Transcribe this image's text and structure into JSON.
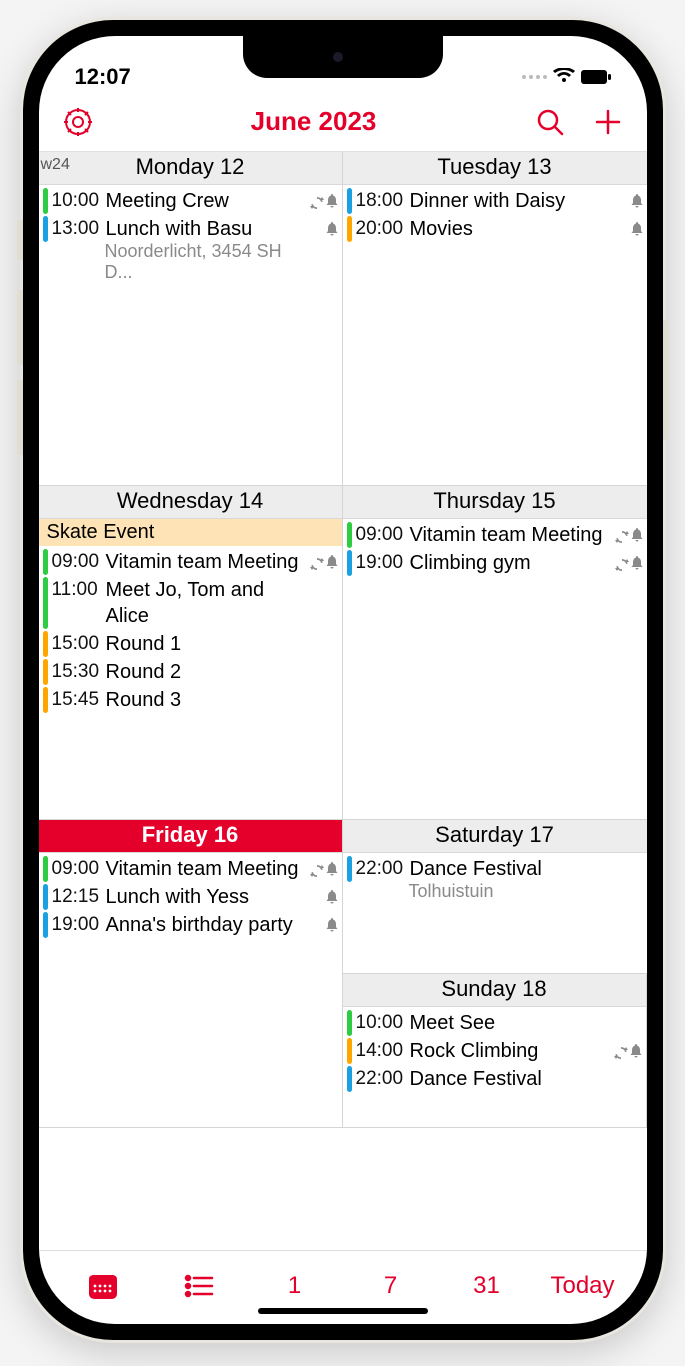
{
  "status": {
    "time": "12:07"
  },
  "header": {
    "title": "June 2023"
  },
  "week_label": "w24",
  "days": [
    {
      "label": "Monday 12",
      "events": [
        {
          "color": "green",
          "time": "10:00",
          "title": "Meeting Crew",
          "repeat": true,
          "bell": true
        },
        {
          "color": "blue",
          "time": "13:00",
          "title": "Lunch with Basu",
          "location": "Noorderlicht, 3454 SH D...",
          "bell": true
        }
      ]
    },
    {
      "label": "Tuesday 13",
      "events": [
        {
          "color": "blue",
          "time": "18:00",
          "title": "Dinner with Daisy",
          "bell": true
        },
        {
          "color": "orange",
          "time": "20:00",
          "title": "Movies",
          "bell": true
        }
      ]
    },
    {
      "label": "Wednesday 14",
      "allday": {
        "color": "orange",
        "title": "Skate Event"
      },
      "events": [
        {
          "color": "green",
          "time": "09:00",
          "title": "Vitamin team Meeting",
          "repeat": true,
          "bell": true
        },
        {
          "color": "green",
          "time": "11:00",
          "title": "Meet Jo, Tom and Alice"
        },
        {
          "color": "orange",
          "time": "15:00",
          "title": "Round 1"
        },
        {
          "color": "orange",
          "time": "15:30",
          "title": "Round 2"
        },
        {
          "color": "orange",
          "time": "15:45",
          "title": "Round 3"
        }
      ]
    },
    {
      "label": "Thursday 15",
      "events": [
        {
          "color": "green",
          "time": "09:00",
          "title": "Vitamin team Meeting",
          "repeat": true,
          "bell": true
        },
        {
          "color": "blue",
          "time": "19:00",
          "title": "Climbing gym",
          "repeat": true,
          "bell": true
        }
      ]
    },
    {
      "label": "Friday 16",
      "today": true,
      "events": [
        {
          "color": "green",
          "time": "09:00",
          "title": "Vitamin team Meeting",
          "repeat": true,
          "bell": true
        },
        {
          "color": "blue",
          "time": "12:15",
          "title": "Lunch with Yess",
          "bell": true
        },
        {
          "color": "blue",
          "time": "19:00",
          "title": "Anna's birthday party",
          "bell": true
        }
      ]
    },
    {
      "label": "Saturday 17",
      "events": [
        {
          "color": "blue",
          "time": "22:00",
          "title": "Dance Festival",
          "location": "Tolhuistuin"
        }
      ]
    },
    {
      "label": "Sunday 18",
      "events": [
        {
          "color": "green",
          "time": "10:00",
          "title": "Meet See"
        },
        {
          "color": "orange",
          "time": "14:00",
          "title": "Rock Climbing",
          "repeat": true,
          "bell": true
        },
        {
          "color": "blue",
          "time": "22:00",
          "title": "Dance Festival"
        }
      ]
    }
  ],
  "toolbar": {
    "calendar_label": "",
    "list_label": "",
    "day_label": "1",
    "week_label": "7",
    "month_label": "31",
    "today_label": "Today"
  }
}
